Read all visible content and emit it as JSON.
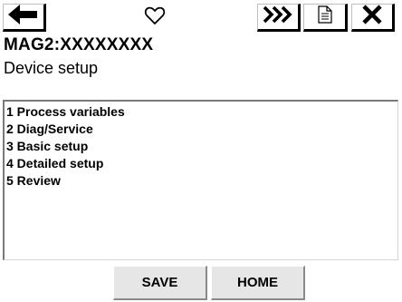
{
  "toolbar": {
    "back_icon": "left-arrow-icon",
    "favorite_icon": "heart-outline-icon",
    "fast_key_icon": "triple-chevron-right-icon",
    "document_icon": "document-icon",
    "close_icon": "x-close-icon"
  },
  "device": {
    "tag": "MAG2:XXXXXXXX"
  },
  "screen": {
    "title": "Device setup"
  },
  "menu": {
    "items": [
      {
        "label": "1 Process variables"
      },
      {
        "label": "2 Diag/Service"
      },
      {
        "label": "3 Basic setup"
      },
      {
        "label": "4 Detailed setup"
      },
      {
        "label": "5 Review"
      }
    ]
  },
  "footer": {
    "save_label": "SAVE",
    "home_label": "HOME"
  },
  "colors": {
    "background": "#ffffff",
    "button_face": "#e6e6e6",
    "text": "#000000"
  }
}
